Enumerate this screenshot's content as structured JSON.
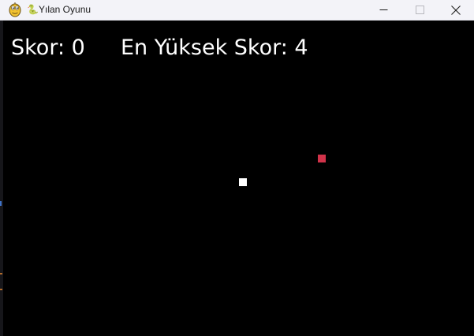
{
  "window": {
    "title": "Yılan Oyunu",
    "title_glyph": "🐍"
  },
  "titlebar_controls": {
    "minimize": "minimize-icon",
    "maximize": "maximize-icon",
    "close": "close-icon"
  },
  "hud": {
    "score_text": "Skor: 0",
    "high_score_text": "En Yüksek Skor: 4"
  },
  "colors": {
    "background": "#000000",
    "snake": "#ffffff",
    "food": "#d1334a",
    "text": "#ffffff",
    "titlebar": "#f3f3f8"
  }
}
